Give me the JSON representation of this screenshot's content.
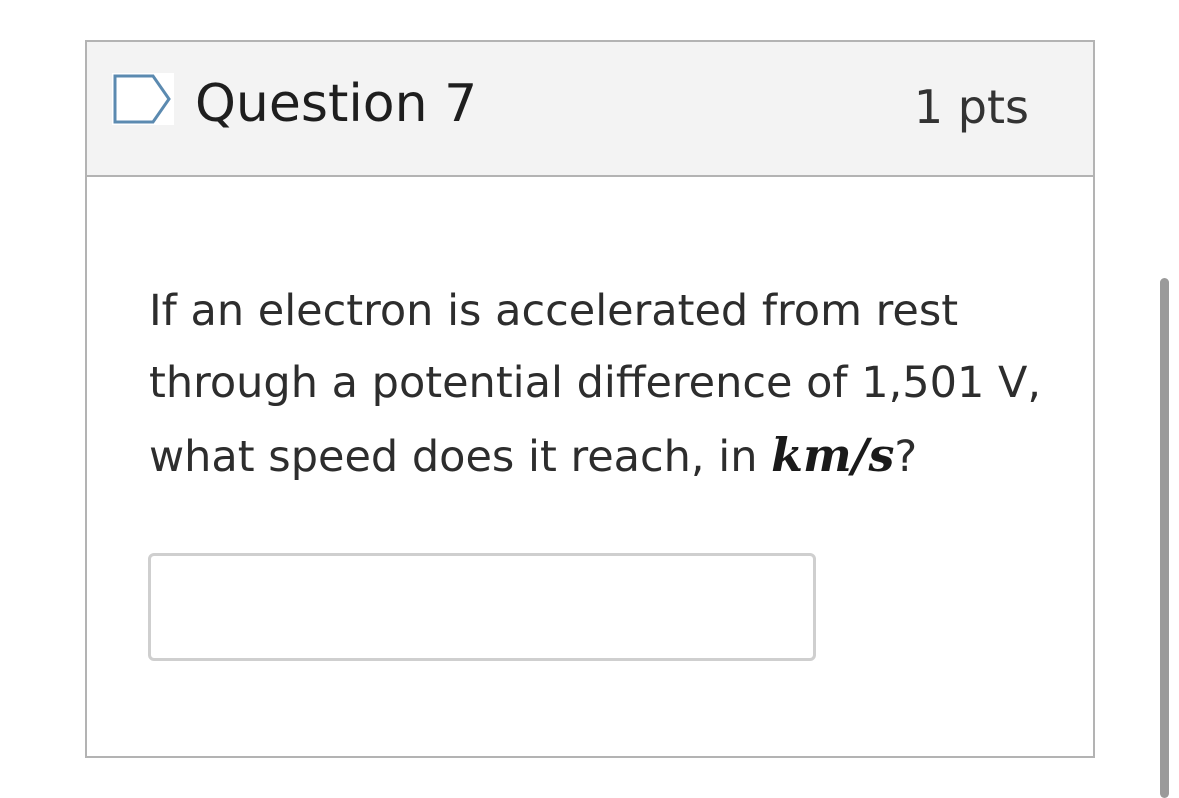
{
  "question": {
    "title": "Question 7",
    "points": "1 pts",
    "flag_icon": "flag-outline-icon",
    "text_part1": "If an electron is accelerated from rest through a potential difference of 1,501 V, what speed does it reach, in ",
    "unit": "km/s",
    "text_part2": "?",
    "answer": {
      "value": "",
      "placeholder": ""
    }
  },
  "colors": {
    "header_bg": "#f3f3f3",
    "border": "#b3b3b3",
    "flag_stroke": "#5b8ab0",
    "input_border": "#cfcfcf"
  }
}
